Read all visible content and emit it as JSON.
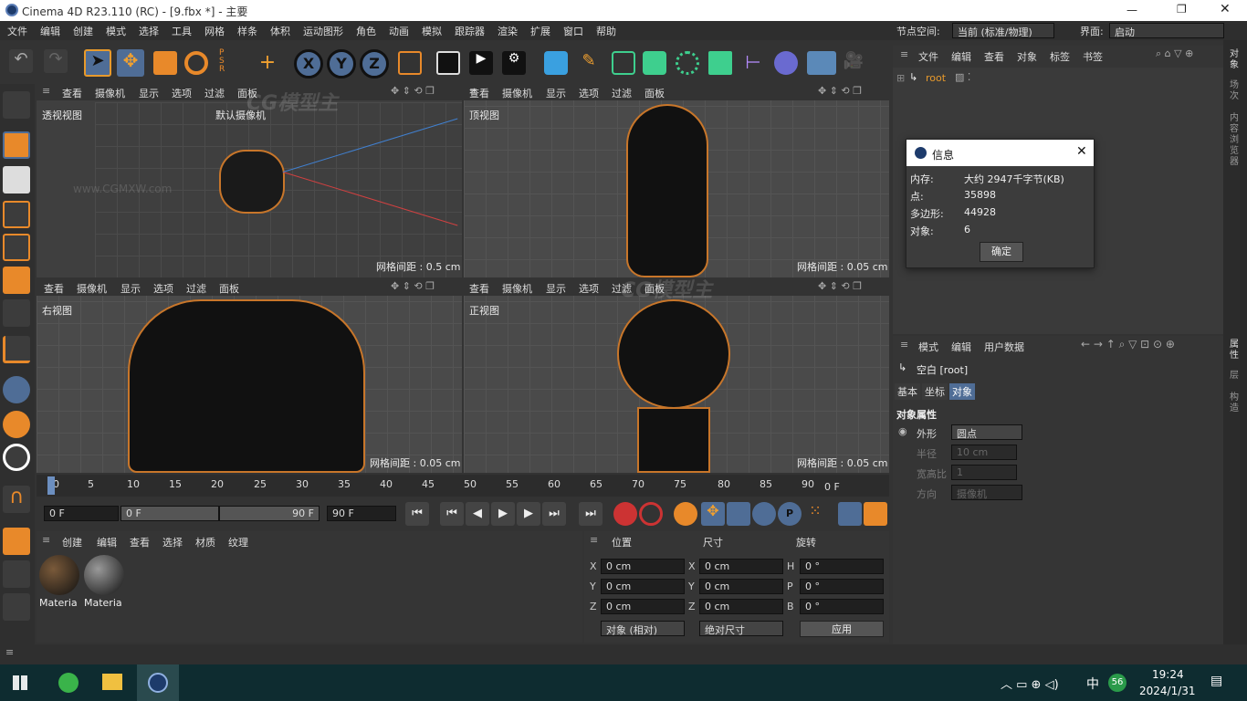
{
  "title": "Cinema 4D R23.110 (RC) - [9.fbx *] - 主要",
  "menus": [
    "文件",
    "编辑",
    "创建",
    "模式",
    "选择",
    "工具",
    "网格",
    "样条",
    "体积",
    "运动图形",
    "角色",
    "动画",
    "模拟",
    "跟踪器",
    "渲染",
    "扩展",
    "窗口",
    "帮助"
  ],
  "node_space_label": "节点空间:",
  "node_space_value": "当前 (标准/物理)",
  "layout_label": "界面:",
  "layout_value": "启动",
  "vp_menu": [
    "查看",
    "摄像机",
    "显示",
    "选项",
    "过滤",
    "面板"
  ],
  "vp_bl_menu": [
    "查看",
    "摄像机",
    "显示",
    "选项",
    "过滤",
    "面板"
  ],
  "viewports": {
    "persp": "透视视图",
    "top": "顶视图",
    "right": "右视图",
    "front": "正视图",
    "camera": "默认摄像机",
    "g1": "网格间距 : 0.5 cm",
    "g2": "网格间距 : 0.05 cm",
    "g3": "网格间距 : 0.05 cm",
    "g4": "网格间距 : 0.05 cm"
  },
  "objmgr": {
    "menu": [
      "文件",
      "编辑",
      "查看",
      "对象",
      "标签",
      "书签"
    ],
    "root": "root"
  },
  "info": {
    "title": "信息",
    "rows": [
      {
        "k": "内存:",
        "v": "大约 2947千字节(KB)"
      },
      {
        "k": "点:",
        "v": "35898"
      },
      {
        "k": "多边形:",
        "v": "44928"
      },
      {
        "k": "对象:",
        "v": "6"
      }
    ],
    "ok": "确定"
  },
  "attr": {
    "menu": [
      "模式",
      "编辑",
      "用户数据"
    ],
    "obj": "空白 [root]",
    "tabs": [
      "基本",
      "坐标",
      "对象"
    ],
    "section": "对象属性",
    "rows": [
      {
        "k": "外形",
        "v": "圆点"
      },
      {
        "k": "半径",
        "v": "10 cm"
      },
      {
        "k": "宽高比",
        "v": "1"
      },
      {
        "k": "方向",
        "v": "摄像机"
      }
    ]
  },
  "right_tabs": [
    "对象",
    "场次",
    "内容浏览器",
    "属性",
    "层",
    "构造"
  ],
  "timeline": {
    "ticks": [
      "0",
      "5",
      "10",
      "15",
      "20",
      "25",
      "30",
      "35",
      "40",
      "45",
      "50",
      "55",
      "60",
      "65",
      "70",
      "75",
      "80",
      "85",
      "90"
    ],
    "end": "0 F",
    "start_f": "0 F",
    "range_a": "0 F",
    "range_b": "90 F",
    "end_f": "90 F"
  },
  "material": {
    "menu": [
      "创建",
      "编辑",
      "查看",
      "选择",
      "材质",
      "纹理"
    ],
    "items": [
      "Materia",
      "Materia"
    ]
  },
  "coords": {
    "headers": [
      "位置",
      "尺寸",
      "旋转"
    ],
    "rows": [
      {
        "a": "X",
        "av": "0 cm",
        "b": "X",
        "bv": "0 cm",
        "c": "H",
        "cv": "0 °"
      },
      {
        "a": "Y",
        "av": "0 cm",
        "b": "Y",
        "bv": "0 cm",
        "c": "P",
        "cv": "0 °"
      },
      {
        "a": "Z",
        "av": "0 cm",
        "b": "Z",
        "bv": "0 cm",
        "c": "B",
        "cv": "0 °"
      }
    ],
    "mode": "对象 (相对)",
    "size_mode": "绝对尺寸",
    "apply": "应用"
  },
  "taskbar": {
    "time": "19:24",
    "date": "2024/1/31",
    "ime": "中",
    "badge": "56"
  },
  "watermark": "CG模型主",
  "wm_url": "www.CGMXW.com"
}
